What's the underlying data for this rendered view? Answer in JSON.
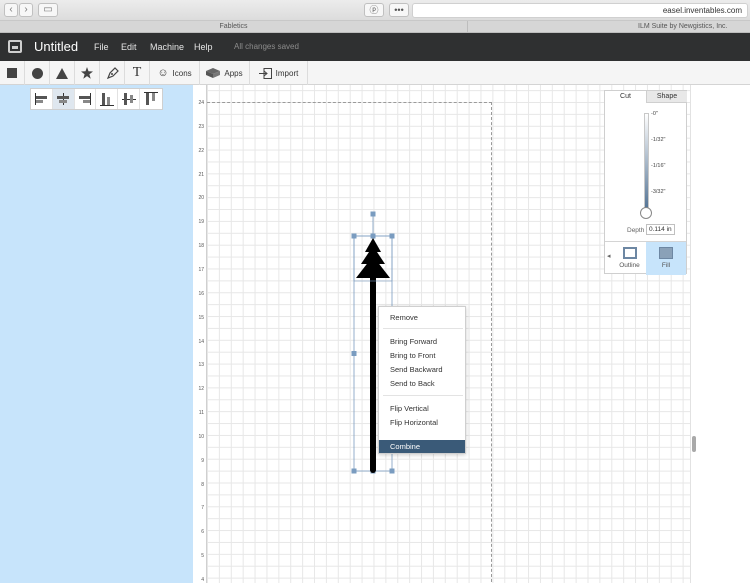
{
  "browser": {
    "address": "easel.inventables.com",
    "tab_1": "Fabletics",
    "tab_2": "ILM Suite by Newgistics, Inc."
  },
  "app": {
    "title": "Untitled",
    "menu": [
      "File",
      "Edit",
      "Machine",
      "Help"
    ],
    "status": "All changes saved"
  },
  "toolbar": {
    "icons_label": "Icons",
    "apps_label": "Apps",
    "import_label": "Import"
  },
  "ruler": {
    "ticks": [
      "24",
      "23",
      "22",
      "21",
      "20",
      "19",
      "18",
      "17",
      "16",
      "15",
      "14",
      "13",
      "12",
      "11",
      "10",
      "9",
      "8",
      "7",
      "6",
      "5",
      "4"
    ]
  },
  "context_menu": {
    "items": [
      "Remove",
      "Bring Forward",
      "Bring to Front",
      "Send Backward",
      "Send to Back",
      "Flip Vertical",
      "Flip Horizontal",
      "Combine"
    ],
    "highlighted": "Combine"
  },
  "cut_panel": {
    "tab_cut": "Cut",
    "tab_shape": "Shape",
    "depth_ticks": [
      "-0\"",
      "-1/32\"",
      "-1/16\"",
      "-3/32\""
    ],
    "depth_label": "Depth",
    "depth_value": "0.114 in",
    "outline_label": "Outline",
    "fill_label": "Fill",
    "selected_style": "Fill"
  },
  "colors": {
    "header": "#2f3031",
    "left_panel": "#c7e4fb",
    "accent": "#3a5a78"
  }
}
